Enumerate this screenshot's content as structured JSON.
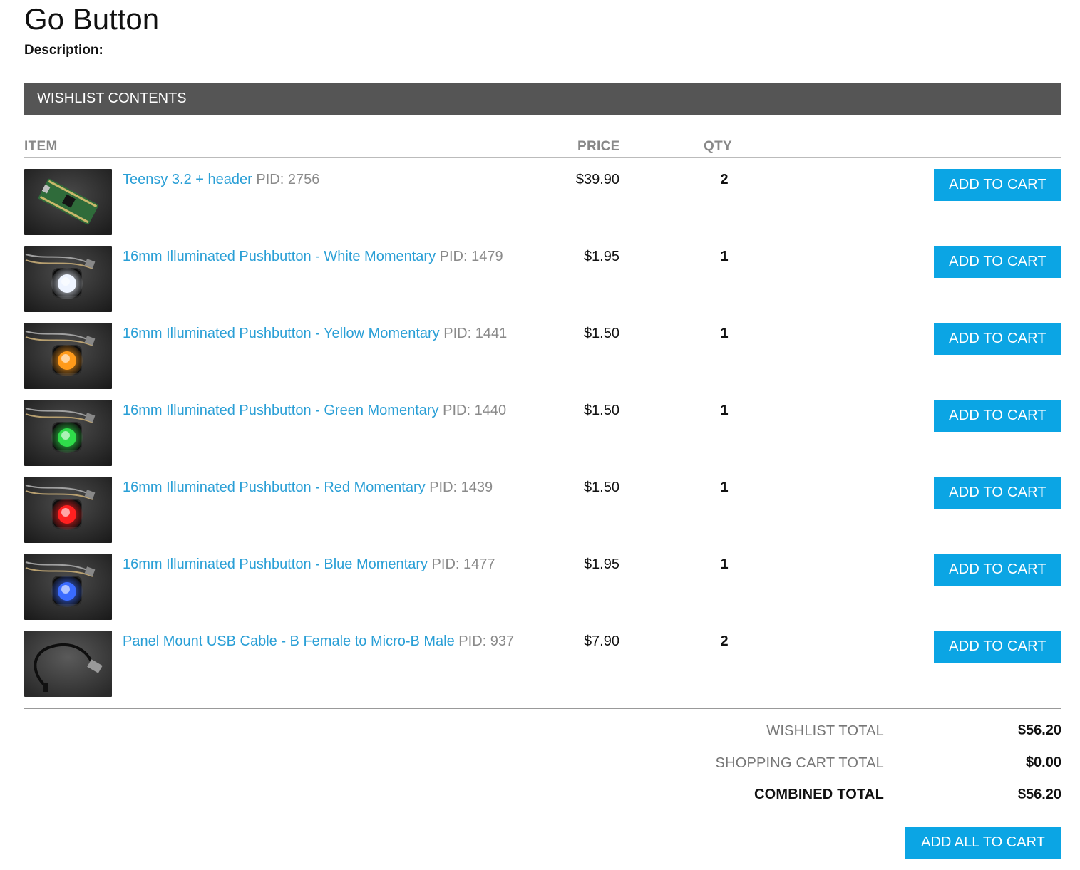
{
  "page": {
    "title": "Go Button",
    "description_label": "Description:"
  },
  "wishlist": {
    "header": "WISHLIST CONTENTS",
    "columns": {
      "item": "ITEM",
      "price": "PRICE",
      "qty": "QTY"
    },
    "add_button_label": "ADD TO CART",
    "pid_label": "PID:",
    "items": [
      {
        "name": "Teensy 3.2 + header",
        "pid": "2756",
        "price": "$39.90",
        "qty": "2",
        "thumb_icon": "teensy-board-photo"
      },
      {
        "name": "16mm Illuminated Pushbutton - White Momentary",
        "pid": "1479",
        "price": "$1.95",
        "qty": "1",
        "thumb_icon": "white-pushbutton-photo",
        "glow": "#eef4ff"
      },
      {
        "name": "16mm Illuminated Pushbutton - Yellow Momentary",
        "pid": "1441",
        "price": "$1.50",
        "qty": "1",
        "thumb_icon": "yellow-pushbutton-photo",
        "glow": "#ff9a1a"
      },
      {
        "name": "16mm Illuminated Pushbutton - Green Momentary",
        "pid": "1440",
        "price": "$1.50",
        "qty": "1",
        "thumb_icon": "green-pushbutton-photo",
        "glow": "#2fdc4a"
      },
      {
        "name": "16mm Illuminated Pushbutton - Red Momentary",
        "pid": "1439",
        "price": "$1.50",
        "qty": "1",
        "thumb_icon": "red-pushbutton-photo",
        "glow": "#ff2020"
      },
      {
        "name": "16mm Illuminated Pushbutton - Blue Momentary",
        "pid": "1477",
        "price": "$1.95",
        "qty": "1",
        "thumb_icon": "blue-pushbutton-photo",
        "glow": "#3a6bff"
      },
      {
        "name": "Panel Mount USB Cable - B Female to Micro-B Male",
        "pid": "937",
        "price": "$7.90",
        "qty": "2",
        "thumb_icon": "usb-cable-photo"
      }
    ]
  },
  "totals": {
    "wishlist_total_label": "WISHLIST TOTAL",
    "wishlist_total": "$56.20",
    "cart_total_label": "SHOPPING CART TOTAL",
    "cart_total": "$0.00",
    "combined_total_label": "COMBINED TOTAL",
    "combined_total": "$56.20",
    "add_all_label": "ADD ALL TO CART"
  },
  "colors": {
    "header_bg": "#555555",
    "button_bg": "#0ba5e4",
    "link": "#2a9fd6",
    "muted": "#8a8a8a"
  }
}
